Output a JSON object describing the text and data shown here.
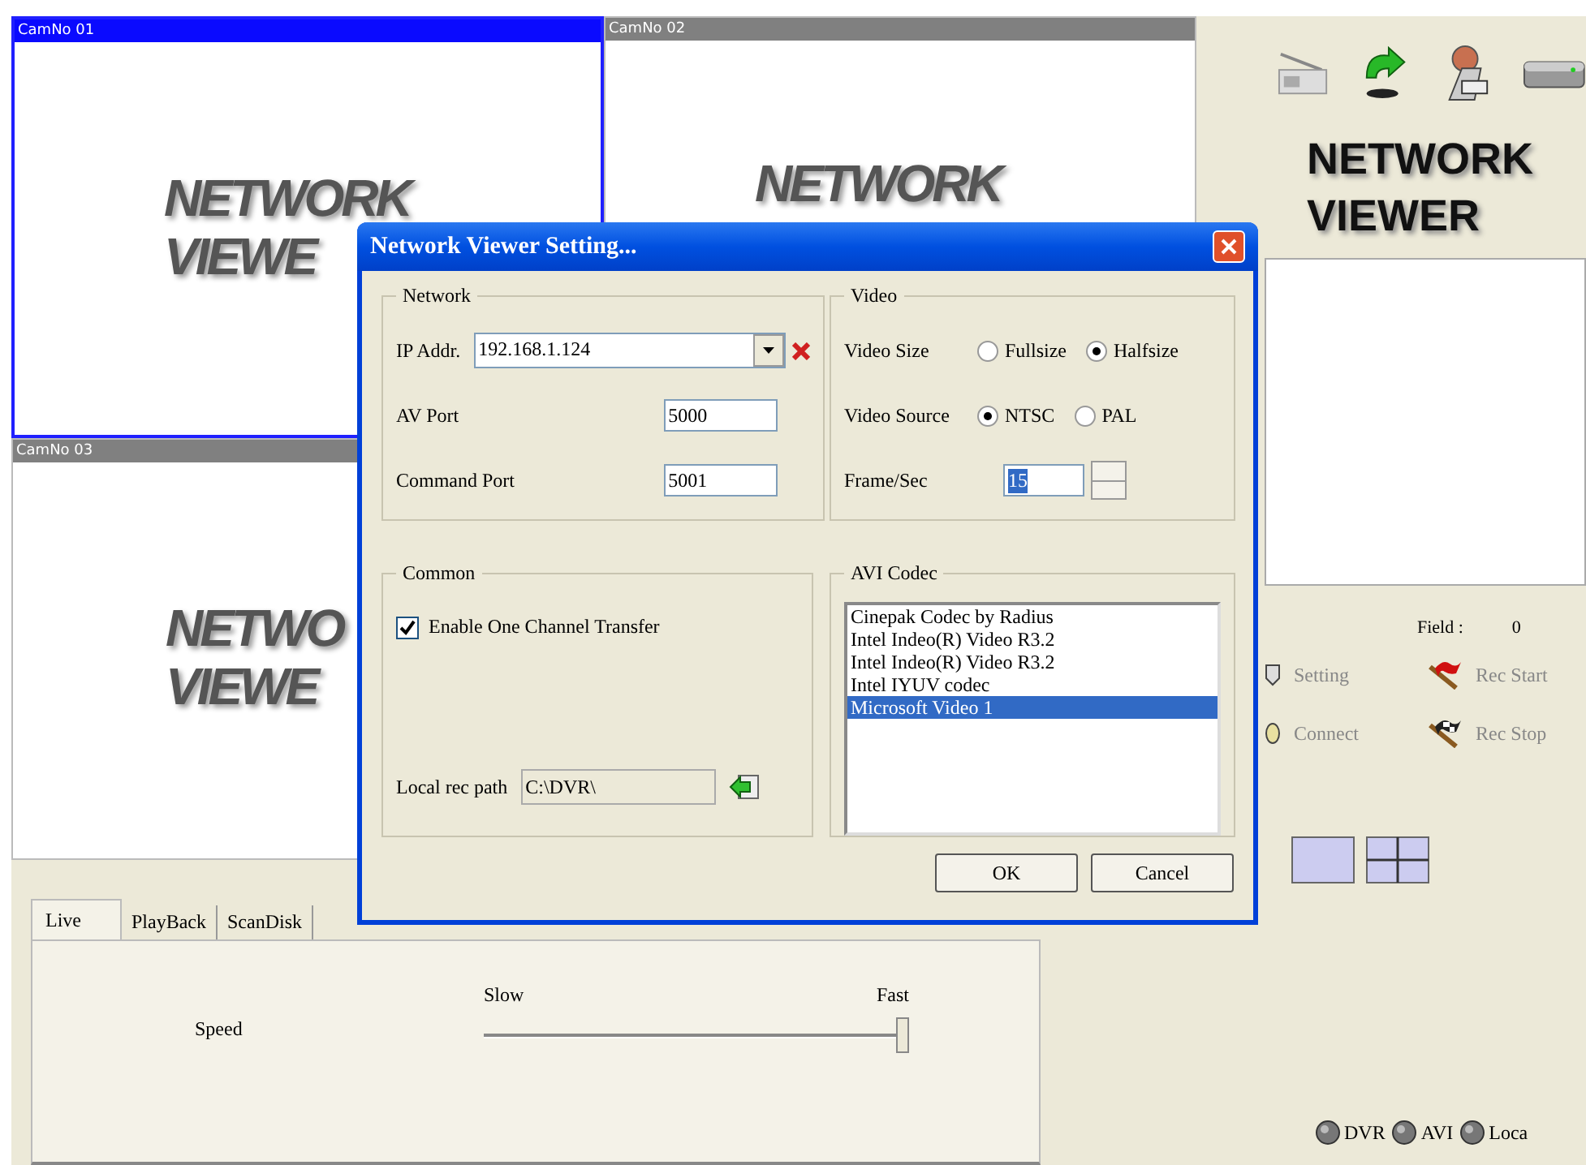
{
  "cameras": [
    {
      "label": "CamNo 01",
      "selected": true,
      "logo": [
        "NETWORK",
        "VIEWE"
      ]
    },
    {
      "label": "CamNo 02",
      "selected": false,
      "logo": [
        "NETWORK"
      ]
    },
    {
      "label": "CamNo 03",
      "selected": false,
      "logo": [
        "NETWO",
        "VIEWE"
      ]
    }
  ],
  "tabs": [
    {
      "label": "Live",
      "selected": true
    },
    {
      "label": "PlayBack",
      "selected": false
    },
    {
      "label": "ScanDisk",
      "selected": false
    }
  ],
  "speed": {
    "label": "Speed",
    "min_label": "Slow",
    "max_label": "Fast",
    "level": 1
  },
  "side_panel": {
    "logo": [
      "NETWORK",
      "VIEWER"
    ],
    "field_label": "Field :",
    "field_value": "0",
    "buttons": [
      {
        "label": "Setting",
        "kind": "setting"
      },
      {
        "label": "Rec Start",
        "kind": "rec_start"
      },
      {
        "label": "Connect",
        "kind": "connect"
      },
      {
        "label": "Rec Stop",
        "kind": "rec_stop"
      }
    ],
    "indicators": [
      "DVR",
      "AVI",
      "Loca"
    ]
  },
  "dialog": {
    "title": "Network Viewer Setting...",
    "network": {
      "title": "Network",
      "ip_label": "IP Addr.",
      "ip_value": "192.168.1.124",
      "av_port_label": "AV Port",
      "av_port_value": "5000",
      "command_port_label": "Command Port",
      "command_port_value": "5001"
    },
    "video": {
      "title": "Video",
      "size_label": "Video Size",
      "size_options": [
        {
          "label": "Fullsize",
          "selected": false
        },
        {
          "label": "Halfsize",
          "selected": true
        }
      ],
      "source_label": "Video Source",
      "source_options": [
        {
          "label": "NTSC",
          "selected": true
        },
        {
          "label": "PAL",
          "selected": false
        }
      ],
      "fps_label": "Frame/Sec",
      "fps_value": "15"
    },
    "common": {
      "title": "Common",
      "checkbox_label": "Enable One Channel Transfer",
      "checked": true,
      "path_label": "Local rec path",
      "path_value": "C:\\DVR\\"
    },
    "codec": {
      "title": "AVI Codec",
      "items": [
        {
          "label": "Cinepak Codec by Radius",
          "selected": false
        },
        {
          "label": "Intel Indeo(R) Video R3.2",
          "selected": false
        },
        {
          "label": "Intel Indeo(R) Video R3.2",
          "selected": false
        },
        {
          "label": "Intel IYUV codec",
          "selected": false
        },
        {
          "label": "Microsoft Video 1",
          "selected": true
        }
      ]
    },
    "buttons": [
      "OK",
      "Cancel"
    ]
  }
}
